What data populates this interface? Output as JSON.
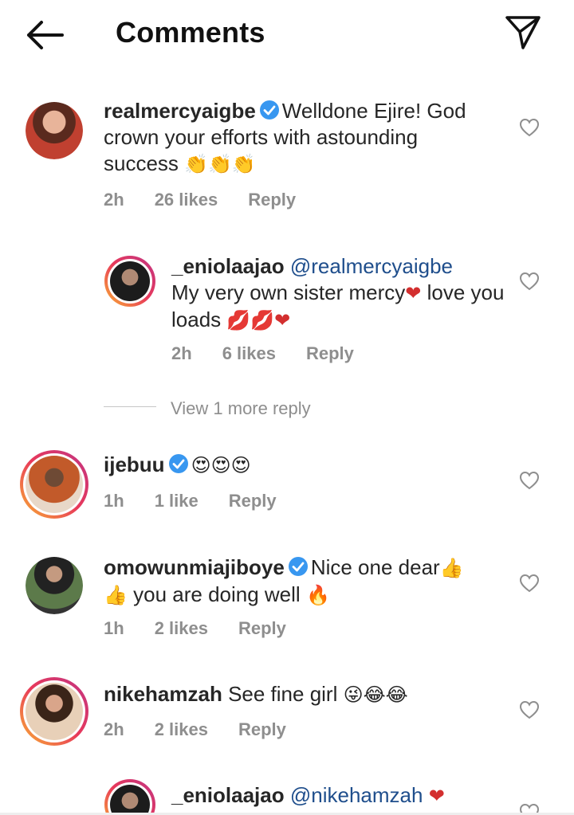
{
  "header": {
    "title": "Comments"
  },
  "comments": [
    {
      "username": "realmercyaigbe",
      "verified": true,
      "text": "Welldone Ejire! God crown your efforts with astounding success",
      "emoji": "👏👏👏",
      "time": "2h",
      "likes": "26 likes",
      "reply": "Reply"
    },
    {
      "username": "_eniolaajao",
      "mention": "@realmercyaigbe",
      "text": "My very own sister mercy",
      "emoji_mid": "❤",
      "text2": "love you loads",
      "emoji": "💋💋❤",
      "time": "2h",
      "likes": "6 likes",
      "reply": "Reply"
    },
    {
      "username": "ijebuu",
      "verified": true,
      "emoji": "😍😍😍",
      "time": "1h",
      "likes": "1 like",
      "reply": "Reply"
    },
    {
      "username": "omowunmiajiboye",
      "verified": true,
      "text": "Nice one dear",
      "emoji_mid": "👍",
      "emoji_start": "👍",
      "text2": "you are doing well",
      "emoji": "🔥",
      "time": "1h",
      "likes": "2 likes",
      "reply": "Reply"
    },
    {
      "username": "nikehamzah",
      "text": "See fine girl",
      "emoji": "😜😂😂",
      "time": "2h",
      "likes": "2 likes",
      "reply": "Reply"
    },
    {
      "username": "_eniolaajao",
      "mention": "@nikehamzah",
      "emoji": "❤"
    }
  ],
  "view_more": "View 1 more reply",
  "icons": {
    "back": "back-arrow-icon",
    "send": "send-icon",
    "heart": "heart-outline-icon",
    "verified": "verified-badge-icon"
  },
  "colors": {
    "verified": "#3897f0",
    "mention": "#1f4e8c",
    "meta": "#8e8e8e"
  }
}
